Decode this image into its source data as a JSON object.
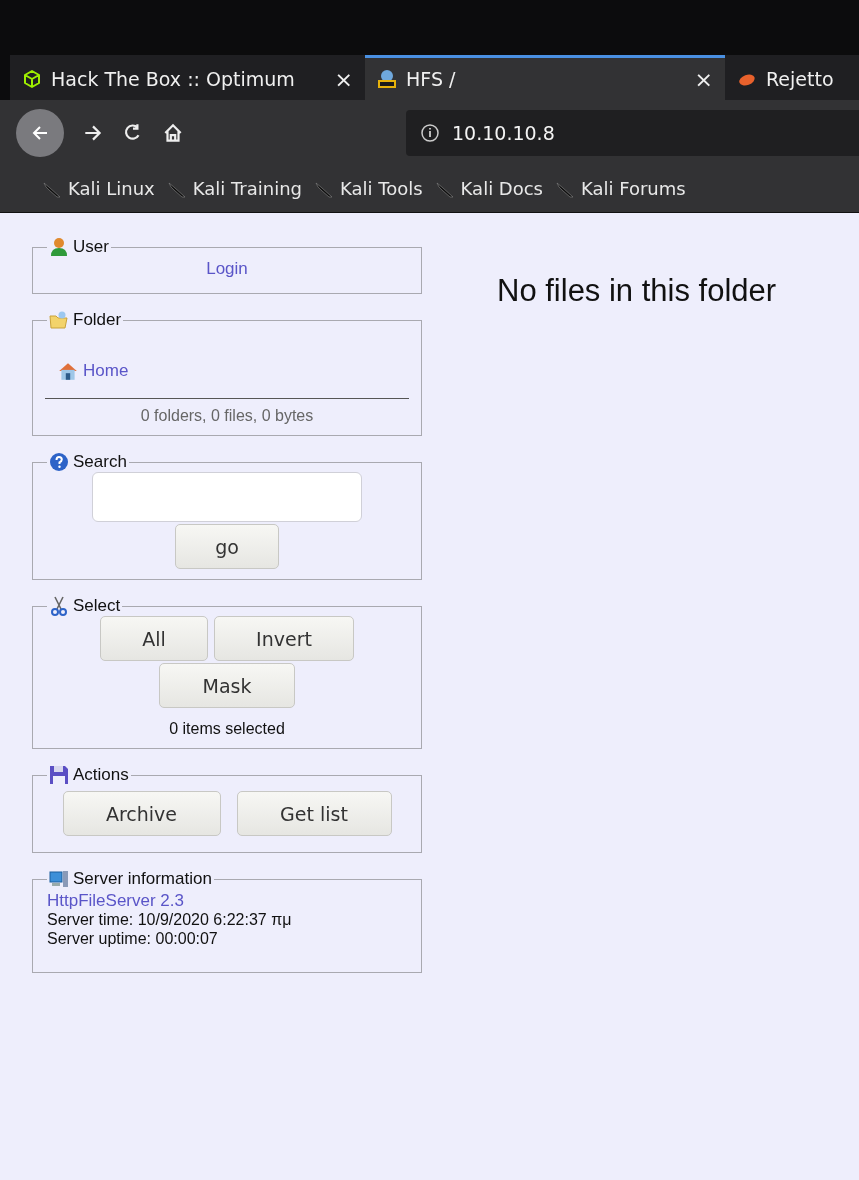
{
  "browser": {
    "tabs": [
      {
        "title": "Hack The Box :: Optimum",
        "close": "×",
        "selected": false
      },
      {
        "title": "HFS /",
        "close": "×",
        "selected": true
      },
      {
        "title": "Rejetto",
        "selected": false
      }
    ],
    "address": "10.10.10.8",
    "bookmarks": [
      "Kali Linux",
      "Kali Training",
      "Kali Tools",
      "Kali Docs",
      "Kali Forums"
    ]
  },
  "sidebar": {
    "panels": [
      {
        "kind": "user",
        "legend": "User",
        "link": "Login"
      },
      {
        "kind": "folder",
        "legend": "Folder",
        "link": "Home",
        "summary": "0 folders, 0 files, 0 bytes"
      },
      {
        "kind": "search",
        "legend": "Search",
        "button": "go"
      },
      {
        "kind": "select",
        "legend": "Select",
        "button_rows": [
          [
            "All",
            "Invert"
          ],
          [
            "Mask"
          ]
        ],
        "summary": "0 items selected"
      },
      {
        "kind": "actions",
        "legend": "Actions",
        "buttons": [
          "Archive",
          "Get list"
        ]
      },
      {
        "kind": "server",
        "legend": "Server information",
        "link": "HttpFileServer 2.3",
        "lines": [
          "Server time: 10/9/2020 6:22:37 πμ",
          "Server uptime: 00:00:07"
        ]
      }
    ]
  },
  "main": {
    "message": "No files in this folder"
  }
}
